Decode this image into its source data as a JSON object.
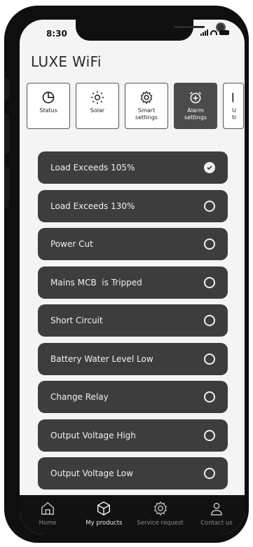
{
  "status_bar": {
    "time": "8:30"
  },
  "app": {
    "title": "LUXE WiFi"
  },
  "tabs": [
    {
      "label": "Status",
      "icon": "pie-chart-icon",
      "active": false
    },
    {
      "label": "Solar",
      "icon": "sun-icon",
      "active": false
    },
    {
      "label": "Smart settings",
      "icon": "gear-icon",
      "active": false
    },
    {
      "label": "Alarm settings",
      "icon": "alarm-clock-icon",
      "active": true
    },
    {
      "label": "U tr",
      "icon": "partial-icon",
      "active": false
    }
  ],
  "alarms": [
    {
      "label": "Load Exceeds 105%",
      "selected": true
    },
    {
      "label": "Load Exceeds 130%",
      "selected": false
    },
    {
      "label": "Power Cut",
      "selected": false
    },
    {
      "label": "Mains MCB  is Tripped",
      "selected": false
    },
    {
      "label": "Short Circuit",
      "selected": false
    },
    {
      "label": "Battery Water Level Low",
      "selected": false
    },
    {
      "label": "Change Relay",
      "selected": false
    },
    {
      "label": "Output Voltage High",
      "selected": false
    },
    {
      "label": "Output Voltage Low",
      "selected": false
    }
  ],
  "bottom_nav": [
    {
      "label": "Home",
      "icon": "home-icon",
      "active": false
    },
    {
      "label": "My products",
      "icon": "box-icon",
      "active": true
    },
    {
      "label": "Service request",
      "icon": "gear-icon",
      "active": false
    },
    {
      "label": "Contact us",
      "icon": "person-icon",
      "active": false
    }
  ],
  "colors": {
    "accent": "#4b4b4b",
    "row_bg": "#3d3d3d",
    "nav_bg": "#111111"
  }
}
